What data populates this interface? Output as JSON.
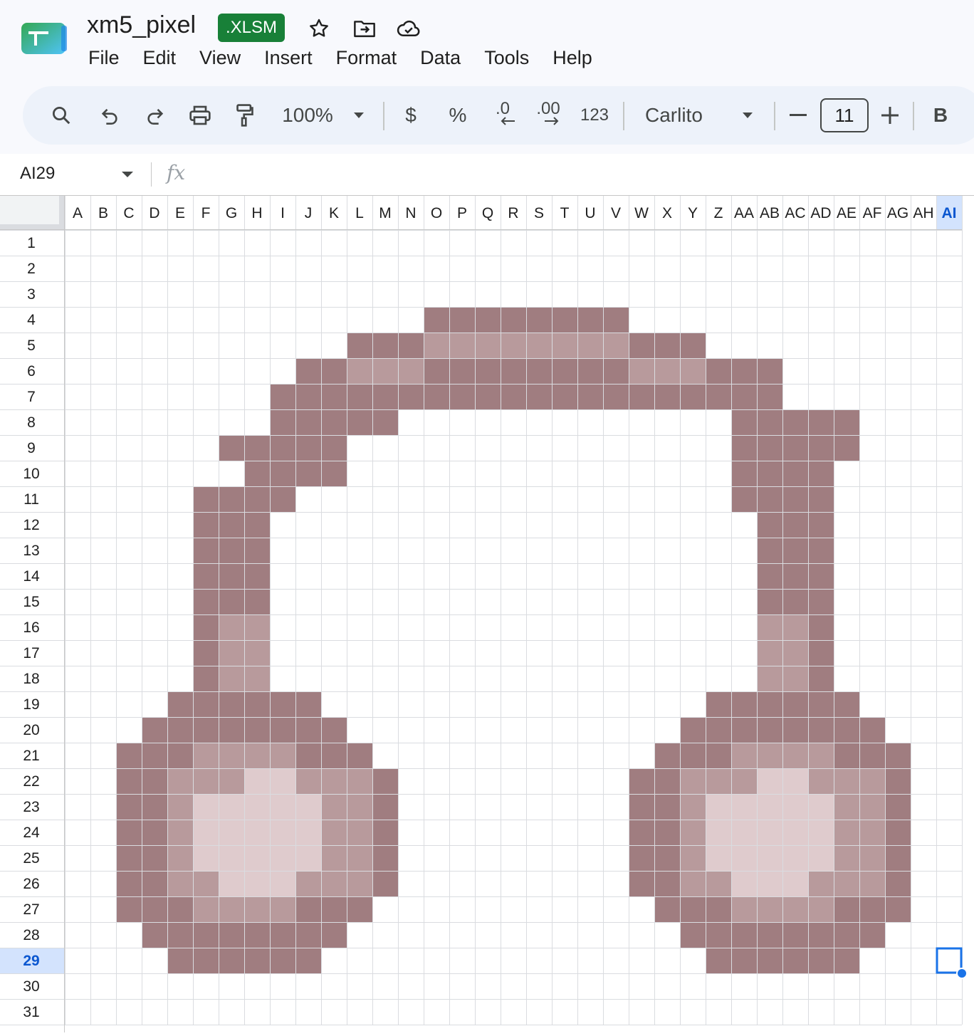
{
  "app": {
    "title": "xm5_pixel",
    "badge": ".XLSM",
    "icons": [
      "sheets-logo-icon",
      "star-icon",
      "move-folder-icon",
      "cloud-saved-icon"
    ]
  },
  "menu": [
    "File",
    "Edit",
    "View",
    "Insert",
    "Format",
    "Data",
    "Tools",
    "Help"
  ],
  "toolbar": {
    "zoom": "100%",
    "currency": "$",
    "percent": "%",
    "decrease_decimal": ".0",
    "increase_decimal": ".00",
    "number_format": "123",
    "font": "Carlito",
    "font_size": "11",
    "bold": "B",
    "icons": [
      "search-icon",
      "undo-icon",
      "redo-icon",
      "print-icon",
      "paint-format-icon",
      "dropdown-icon",
      "minus-icon",
      "plus-icon"
    ]
  },
  "formula_bar": {
    "name_box": "AI29",
    "fx": "fx",
    "value": ""
  },
  "sheet": {
    "columns": [
      "A",
      "B",
      "C",
      "D",
      "E",
      "F",
      "G",
      "H",
      "I",
      "J",
      "K",
      "L",
      "M",
      "N",
      "O",
      "P",
      "Q",
      "R",
      "S",
      "T",
      "U",
      "V",
      "W",
      "X",
      "Y",
      "Z",
      "AA",
      "AB",
      "AC",
      "AD",
      "AE",
      "AF",
      "AG",
      "AH",
      "AI"
    ],
    "rows": [
      "1",
      "2",
      "3",
      "4",
      "5",
      "6",
      "7",
      "8",
      "9",
      "10",
      "11",
      "12",
      "13",
      "14",
      "15",
      "16",
      "17",
      "18",
      "19",
      "20",
      "21",
      "22",
      "23",
      "24",
      "25",
      "26",
      "27",
      "28",
      "29",
      "30",
      "31"
    ],
    "selected_cell": "AI29",
    "selected_col": "AI",
    "selected_row": "29",
    "colors": {
      "1": "#a07d80",
      "2": "#b89a9c",
      "3": "#dfcbcd"
    },
    "pixel_map": [
      "...................................",
      "...................................",
      "...................................",
      "..............11111111.............",
      "...........11122222222111..........",
      ".........1122211111111222111.......",
      "........11111111111111111111.......",
      "........11111.............11111....",
      "......11111...............11111....",
      ".......1111...............1111.....",
      ".....1111.................1111.....",
      ".....111...................111.....",
      ".....111...................111.....",
      ".....111...................111.....",
      ".....111...................111.....",
      ".....122...................221.....",
      ".....122...................221.....",
      ".....122...................221.....",
      "....111111...............111111....",
      "...11111111.............11111111...",
      "..1112222111...........1112222111..",
      "..11222332221.........11222332221..",
      "..11233333221.........11233333221..",
      "..11233333221.........11233333221..",
      "..11233333221.........11233333221..",
      "..11223332221.........11223332221..",
      "..1112222111...........1112222111..",
      "...11111111.............11111111...",
      "....111111...............111111....",
      "...................................",
      "..................................."
    ]
  }
}
